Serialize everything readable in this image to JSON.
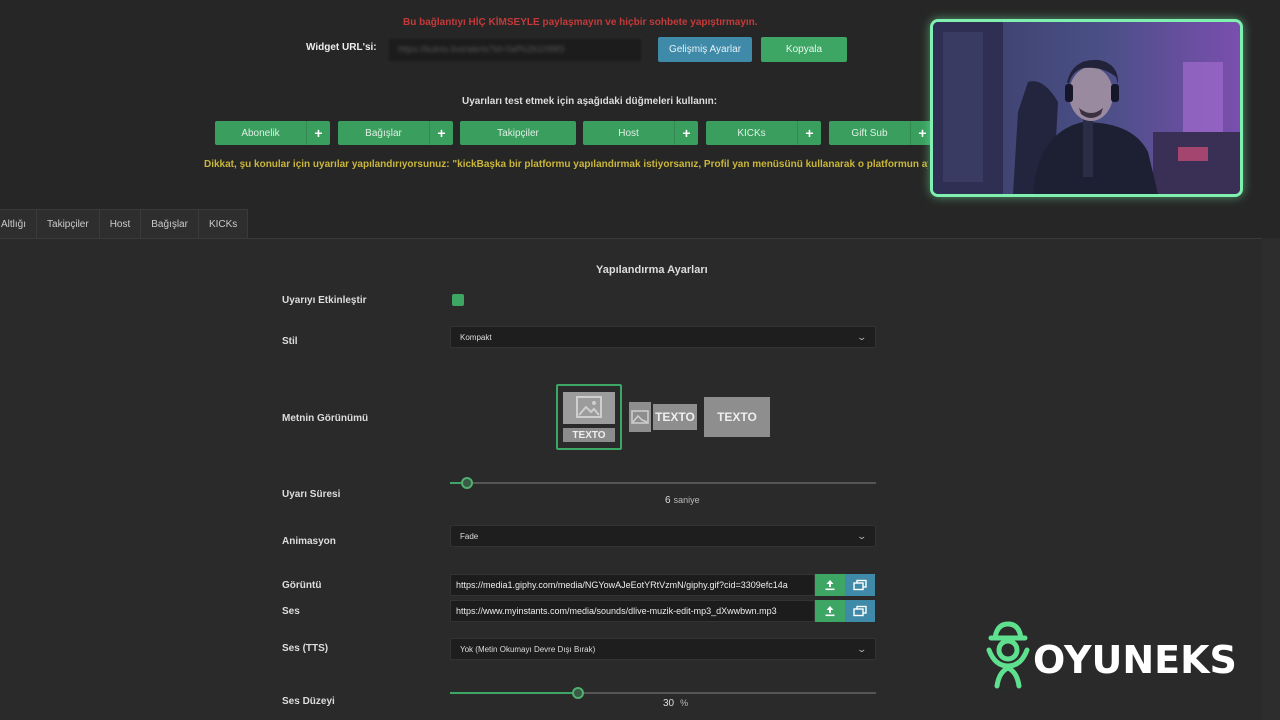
{
  "header": {
    "warning": "Bu bağlantıyı HİÇ KİMSEYLE paylaşmayın ve hiçbir sohbete yapıştırmayın.",
    "widget_url_label": "Widget URL'si:",
    "widget_url_value": "https://kutnix.live/alerts?id=0af%2b1098f3",
    "advanced_button": "Gelişmiş Ayarlar",
    "copy_button": "Kopyala",
    "test_instruction": "Uyarıları test etmek için aşağıdaki düğmeleri kullanın:",
    "test_buttons": [
      "Abonelik",
      "Bağışlar",
      "Takipçiler",
      "Host",
      "KICKs",
      "Gift Sub"
    ],
    "notice": "Dikkat, şu konular için uyarılar yapılandırıyorsunuz: \"kickBaşka bir platformu yapılandırmak istiyorsanız, Profil yan menüsünü kullanarak o platformun ayarlarına"
  },
  "tabs": [
    "Altlığı",
    "Takipçiler",
    "Host",
    "Bağışlar",
    "KICKs"
  ],
  "config": {
    "title": "Yapılandırma Ayarları",
    "enable_label": "Uyarıyı Etkinleştir",
    "enabled": true,
    "style_label": "Stil",
    "style_value": "Kompakt",
    "text_appearance_label": "Metnin Görünümü",
    "layout_options": [
      "TEXTO",
      "TEXTO",
      "TEXTO"
    ],
    "duration_label": "Uyarı Süresi",
    "duration_value": "6",
    "duration_unit": "saniye",
    "duration_fraction": 0.04,
    "animation_label": "Animasyon",
    "animation_value": "Fade",
    "image_label": "Görüntü",
    "image_url": "https://media1.giphy.com/media/NGYowAJeEotYRtVzmN/giphy.gif?cid=3309efc14a",
    "sound_label": "Ses",
    "sound_url": "https://www.myinstants.com/media/sounds/dlive-muzik-edit-mp3_dXwwbwn.mp3",
    "tts_label": "Ses (TTS)",
    "tts_value": "Yok (Metin Okumayı Devre Dışı Bırak)",
    "volume_label": "Ses Düzeyi",
    "volume_value": "30",
    "volume_unit": "%",
    "volume_fraction": 0.3
  },
  "brand": {
    "logo_text": "OYUNEKS",
    "accent_color": "#3da664",
    "info_color": "#3f8aa8"
  }
}
